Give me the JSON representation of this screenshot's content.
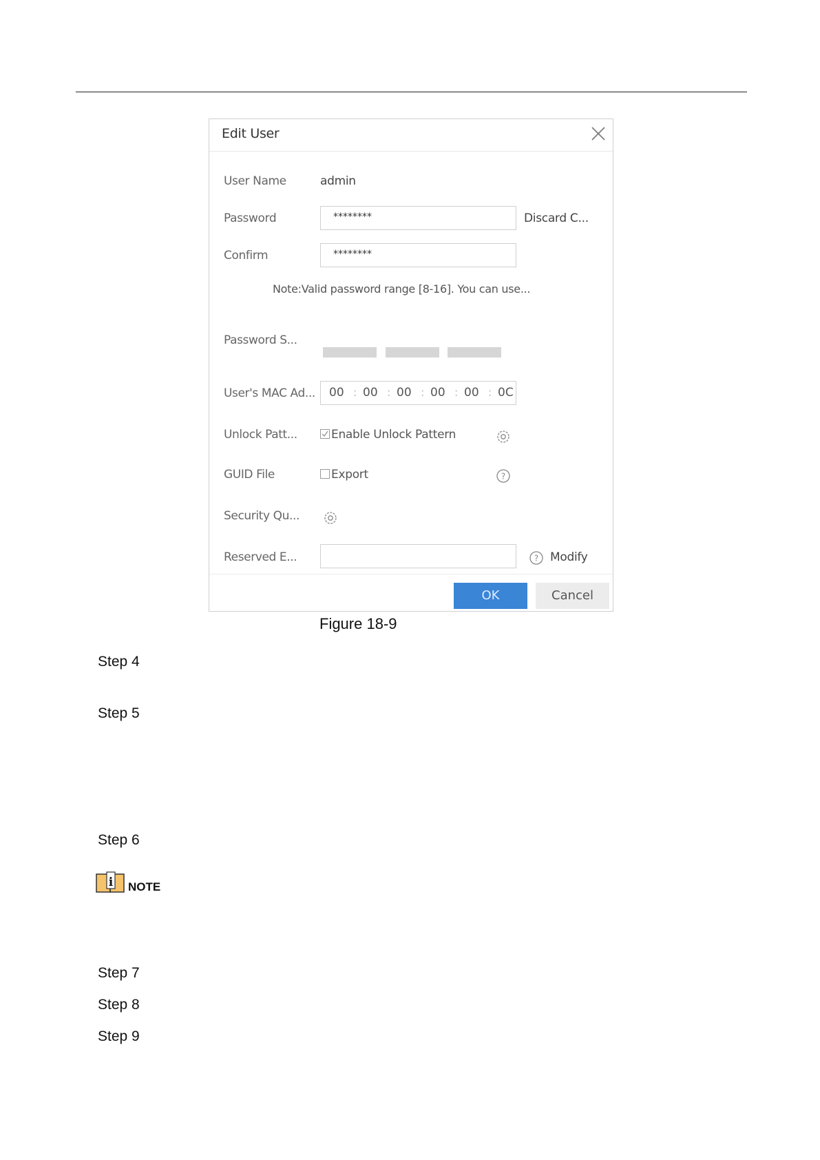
{
  "dialog": {
    "title": "Edit User",
    "fields": {
      "user_name_label": "User Name",
      "user_name_value": "admin",
      "password_label": "Password",
      "password_value": "********",
      "discard_label": "Discard C...",
      "confirm_label": "Confirm",
      "confirm_value": "********",
      "note": "Note:Valid password range [8-16]. You can use...",
      "password_strength_label": "Password S...",
      "mac_label": "User's MAC Ad...",
      "mac_segments": [
        "00",
        "00",
        "00",
        "00",
        "00",
        "0C"
      ],
      "unlock_pattern_label": "Unlock Patt...",
      "unlock_pattern_option": "Enable Unlock Pattern",
      "unlock_pattern_checked": true,
      "guid_label": "GUID File",
      "guid_option": "Export",
      "guid_checked": false,
      "security_label": "Security Qu...",
      "reserved_label": "Reserved E...",
      "reserved_value": "",
      "modify_label": "Modify"
    },
    "buttons": {
      "ok": "OK",
      "cancel": "Cancel"
    }
  },
  "figure_caption": "Figure 18-9",
  "steps": [
    "Step 4",
    "Step 5",
    "Step 6",
    "Step 7",
    "Step 8",
    "Step 9"
  ],
  "note_label": "NOTE"
}
